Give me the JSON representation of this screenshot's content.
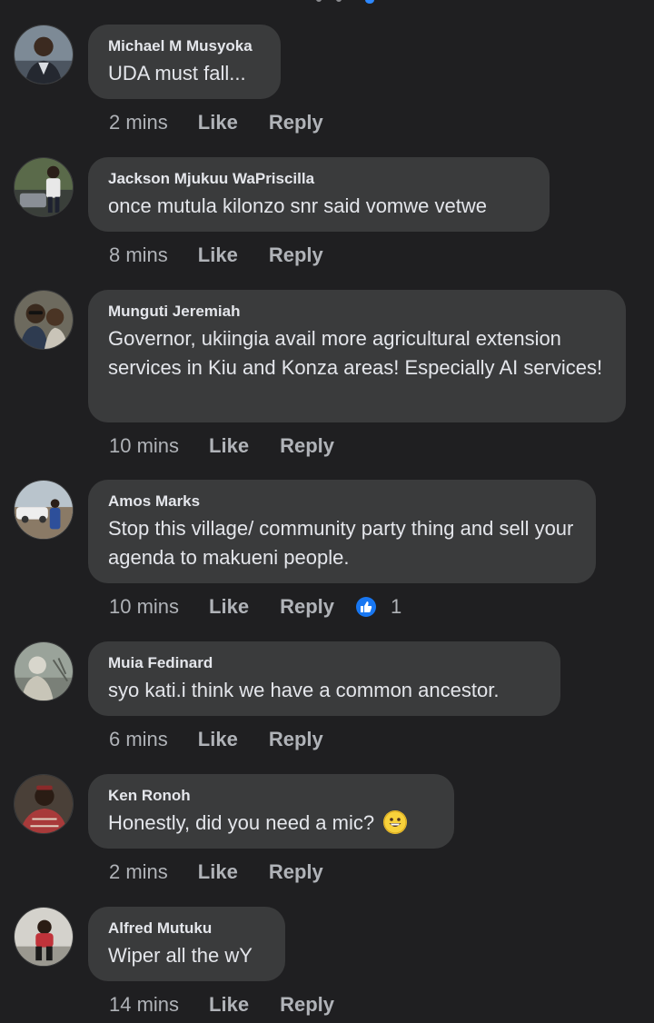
{
  "comments": [
    {
      "author": "Michael M Musyoka",
      "text": "UDA must fall...",
      "time": "2 mins",
      "like": "Like",
      "reply": "Reply"
    },
    {
      "author": "Jackson Mjukuu WaPriscilla",
      "text": "once mutula kilonzo snr said vomwe vetwe",
      "time": "8 mins",
      "like": "Like",
      "reply": "Reply"
    },
    {
      "author": "Munguti Jeremiah",
      "text": "Governor, ukiingia avail more agricultural extension services in Kiu and Konza areas! Especially AI services!",
      "time": "10 mins",
      "like": "Like",
      "reply": "Reply"
    },
    {
      "author": "Amos Marks",
      "text": "Stop this village/ community party thing and sell your agenda to makueni people.",
      "time": "10 mins",
      "like": "Like",
      "reply": "Reply",
      "reaction_count": "1",
      "reaction_icon": "thumbs-up-icon"
    },
    {
      "author": "Muia Fedinard",
      "text": "syo kati.i think we have a common ancestor.",
      "time": "6 mins",
      "like": "Like",
      "reply": "Reply"
    },
    {
      "author": "Ken Ronoh",
      "text": "Honestly, did you need a mic?",
      "emoji": "grinning-face-icon",
      "time": "2 mins",
      "like": "Like",
      "reply": "Reply"
    },
    {
      "author": "Alfred Mutuku",
      "text": "Wiper all the wY",
      "time": "14 mins",
      "like": "Like",
      "reply": "Reply"
    }
  ],
  "colors": {
    "background": "#1f1f21",
    "bubble": "#3a3b3c",
    "text": "#e4e6eb",
    "secondary": "#b0b3b8",
    "accent": "#1877f2"
  }
}
